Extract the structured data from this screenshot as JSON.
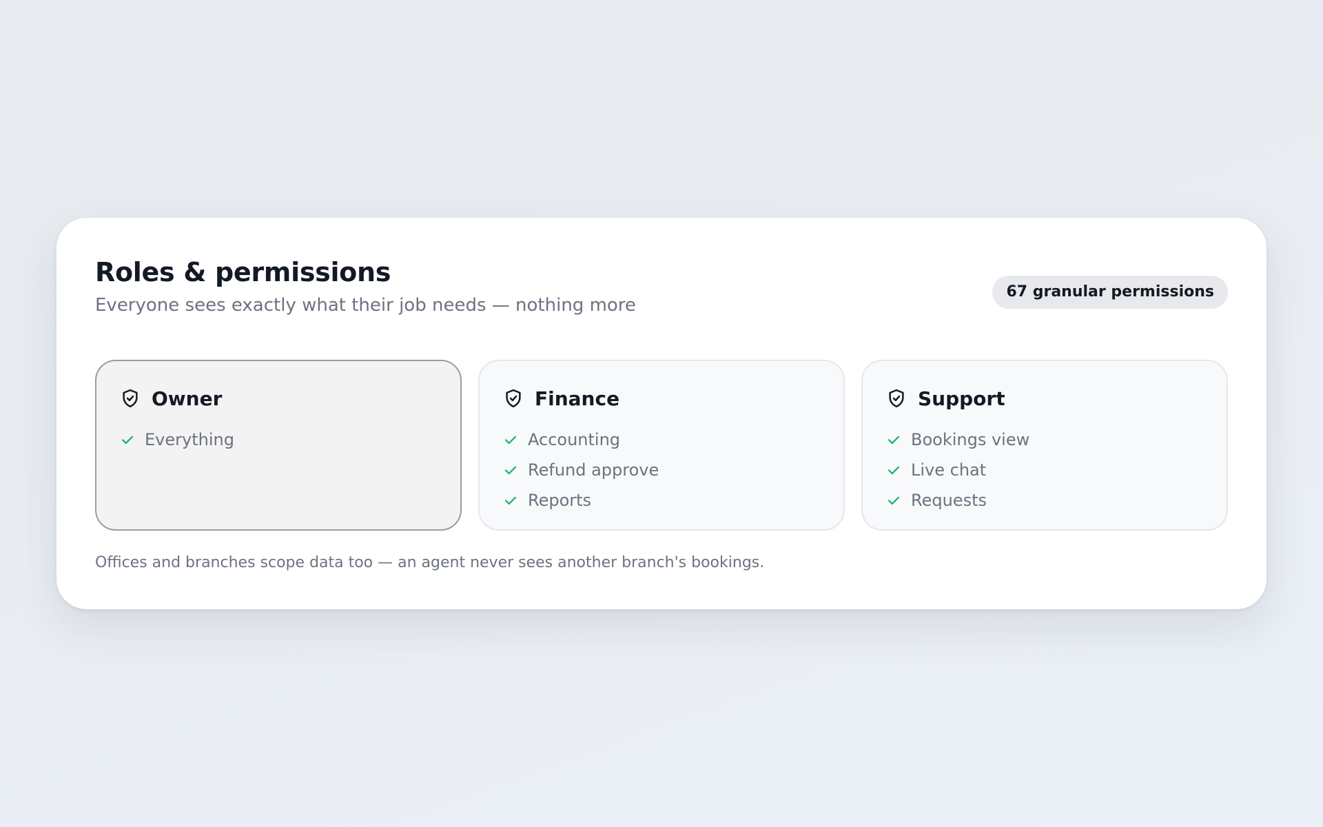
{
  "card": {
    "title": "Roles & permissions",
    "subtitle": "Everyone sees exactly what their job needs — nothing more",
    "badge": "67 granular permissions",
    "footnote": "Offices and branches scope data too — an agent never sees another branch's bookings."
  },
  "roles": [
    {
      "name": "Owner",
      "icon": "shield-check-icon",
      "selected": true,
      "permissions": [
        "Everything"
      ]
    },
    {
      "name": "Finance",
      "icon": "shield-check-icon",
      "selected": false,
      "permissions": [
        "Accounting",
        "Refund approve",
        "Reports"
      ]
    },
    {
      "name": "Support",
      "icon": "shield-check-icon",
      "selected": false,
      "permissions": [
        "Bookings view",
        "Live chat",
        "Requests"
      ]
    }
  ],
  "colors": {
    "title": "#141a24",
    "muted": "#6b7280",
    "check": "#1fb574",
    "badge_bg": "#e8e9ec"
  }
}
